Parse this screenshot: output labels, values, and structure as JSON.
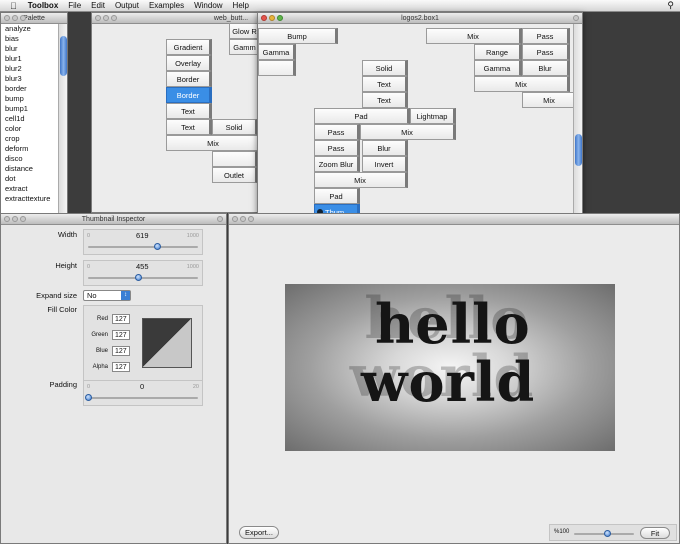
{
  "menubar": {
    "app": "Toolbox",
    "items": [
      "File",
      "Edit",
      "Output",
      "Examples",
      "Window",
      "Help"
    ]
  },
  "palette": {
    "title": "Palette",
    "items": [
      "analyze",
      "bias",
      "blur",
      "blur1",
      "blur2",
      "blur3",
      "border",
      "bump",
      "bump1",
      "cell1d",
      "color",
      "crop",
      "deform",
      "disco",
      "distance",
      "dot",
      "extract",
      "extracttexture"
    ]
  },
  "web_window": {
    "title": "web_butt...",
    "nodes": [
      "Gradient",
      "Overlay",
      "Border",
      "Border",
      "Text",
      "Text",
      "Solid",
      "Mix",
      "Outlet",
      "Glow R",
      "Gamm"
    ],
    "selected_node": "Border"
  },
  "logos_window": {
    "title": "logos2.box1",
    "nodes": [
      "Bump",
      "Gamma",
      "Mix",
      "Pass",
      "Range",
      "Pass",
      "Gamma",
      "Blur",
      "Mix",
      "Mix",
      "Solid",
      "Text",
      "Text",
      "Pad",
      "Lightmap",
      "Pass",
      "Mix",
      "Pass",
      "Blur",
      "Zoom Blur",
      "Invert",
      "Mix",
      "Pad",
      "Thum..."
    ],
    "selected_node": "Thum..."
  },
  "inspector": {
    "title": "Thumbnail Inspector",
    "width": {
      "label": "Width",
      "value": "619",
      "min": "0",
      "max": "1000",
      "fraction": 0.619
    },
    "height": {
      "label": "Height",
      "value": "455",
      "min": "0",
      "max": "1000",
      "fraction": 0.455
    },
    "expand": {
      "label": "Expand size",
      "value": "No"
    },
    "fill": {
      "label": "Fill Color",
      "red_label": "Red",
      "red": "127",
      "green_label": "Green",
      "green": "127",
      "blue_label": "Blue",
      "blue": "127",
      "alpha_label": "Alpha",
      "alpha": "127"
    },
    "padding": {
      "label": "Padding",
      "value": "0",
      "min": "0",
      "max": "20",
      "fraction": 0
    }
  },
  "preview": {
    "image_text_line1": "hello",
    "image_text_line2": "world",
    "export_label": "Export...",
    "zoom_label": "%100",
    "fit_label": "Fit",
    "zoom_fraction": 0.55
  },
  "colors": {
    "selection": "#3a8ee6",
    "fill_dark": "#3a3a3a",
    "fill_light": "#c8c8c8"
  }
}
